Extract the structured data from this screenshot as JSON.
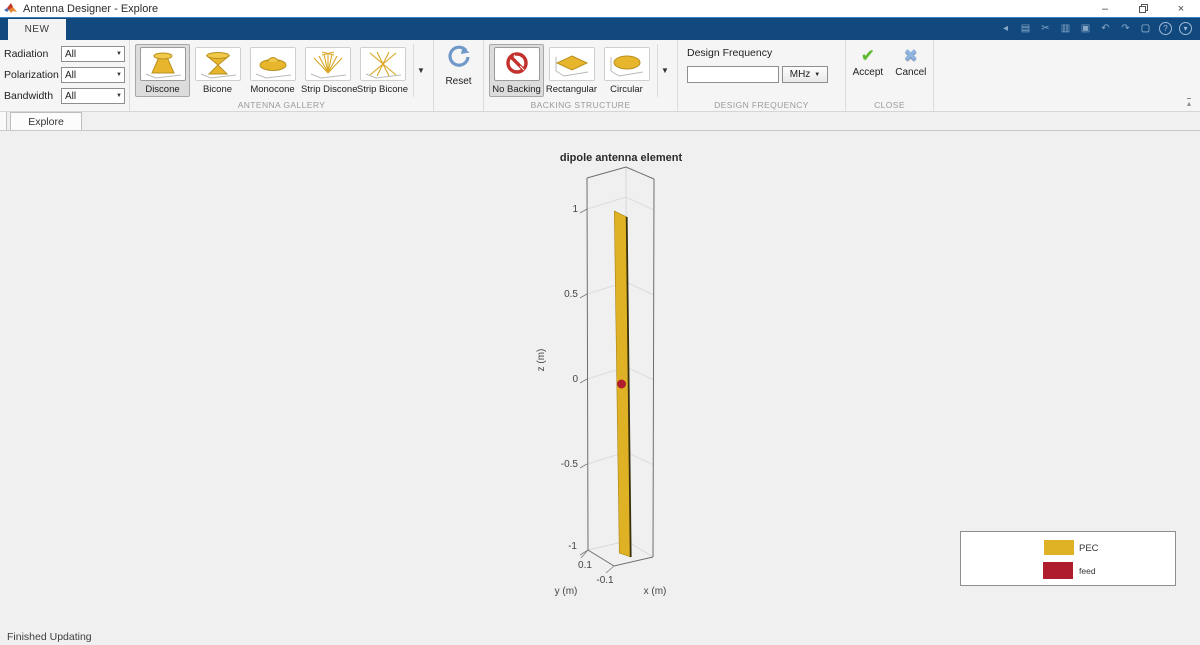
{
  "window": {
    "title": "Antenna Designer - Explore",
    "minimize_glyph": "–",
    "close_glyph": "×"
  },
  "icons": {
    "select_arrow": "▼",
    "gallery_arrow": "▼",
    "back_chevron": "◂",
    "accept_check": "✔",
    "cancel_cross": "✖",
    "collapse_ribbon": "▴",
    "qa_glyphs": [
      "▤",
      "✂",
      "▥",
      "▣",
      "↶",
      "↷",
      "▢",
      "?",
      "▾"
    ]
  },
  "ribbon": {
    "tab_new": "NEW",
    "filters": {
      "radiation": {
        "label": "Radiation",
        "value": "All"
      },
      "polarization": {
        "label": "Polarization",
        "value": "All"
      },
      "bandwidth": {
        "label": "Bandwidth",
        "value": "All"
      }
    },
    "antenna_gallery": {
      "group_label": "ANTENNA GALLERY",
      "items": [
        {
          "label": "Discone",
          "selected": true
        },
        {
          "label": "Bicone",
          "selected": false
        },
        {
          "label": "Monocone",
          "selected": false
        },
        {
          "label": "Strip Discone",
          "selected": false
        },
        {
          "label": "Strip Bicone",
          "selected": false
        }
      ]
    },
    "reset": {
      "label": "Reset"
    },
    "backing_structure": {
      "group_label": "BACKING STRUCTURE",
      "items": [
        {
          "label": "No Backing",
          "selected": true
        },
        {
          "label": "Rectangular",
          "selected": false
        },
        {
          "label": "Circular",
          "selected": false
        }
      ]
    },
    "design_frequency": {
      "group_label": "DESIGN FREQUENCY",
      "field_label": "Design Frequency",
      "value": "",
      "unit": "MHz"
    },
    "close_group": {
      "group_label": "CLOSE",
      "accept_label": "Accept",
      "cancel_label": "Cancel"
    }
  },
  "document": {
    "tab_label": "Explore"
  },
  "plot": {
    "title": "dipole antenna element",
    "xlabel": "x (m)",
    "ylabel": "y (m)",
    "zlabel": "z (m)",
    "z_ticks": [
      "1",
      "0.5",
      "0",
      "-0.5",
      "-1"
    ],
    "y_tick_label": "0.1",
    "x_tick_label": "-0.1",
    "colors": {
      "pec": "#DFB226",
      "feed": "#AF1C2E"
    },
    "legend": [
      {
        "label": "PEC"
      },
      {
        "label": "feed"
      }
    ]
  },
  "status_bar": {
    "text": "Finished Updating"
  }
}
